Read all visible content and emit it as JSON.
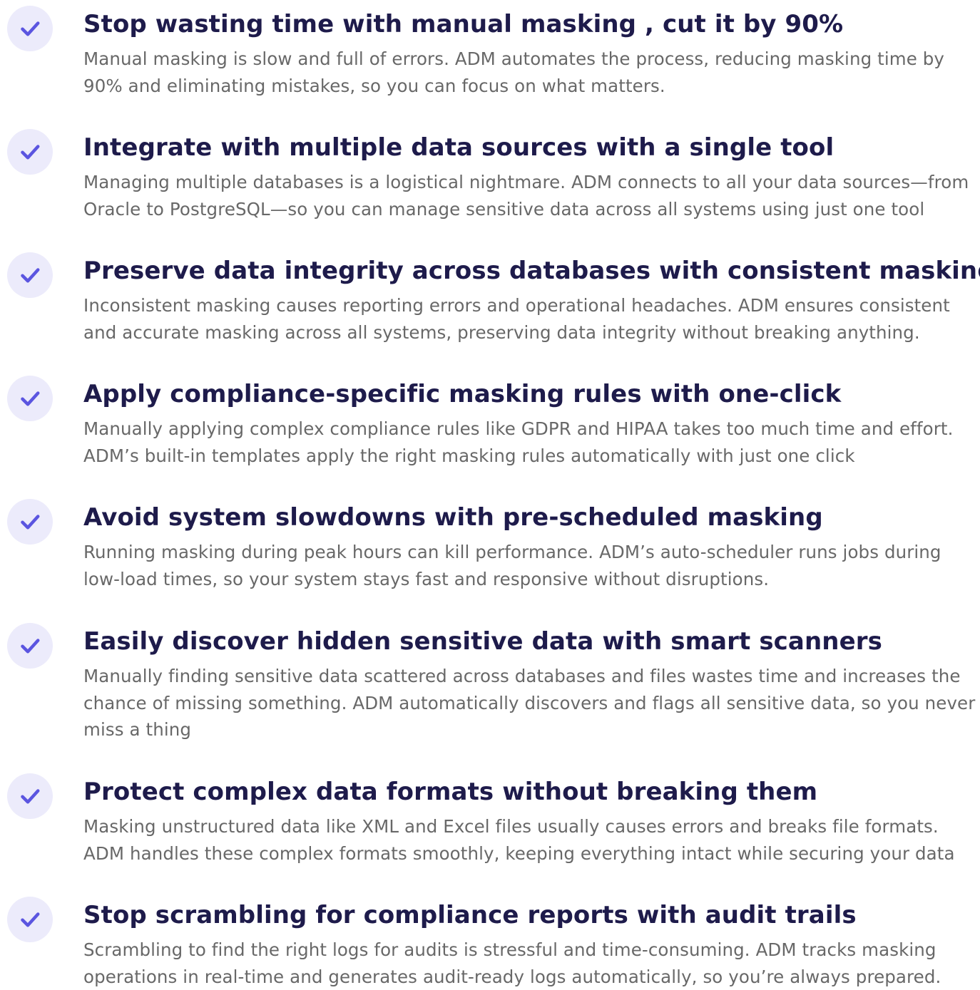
{
  "colors": {
    "title": "#1e1b4b",
    "description": "#686868",
    "check_icon": "#5b55e0",
    "check_badge_background": "#ecebfb",
    "page_background": "#ffffff"
  },
  "features": [
    {
      "icon": "check-icon",
      "title": "Stop wasting time with manual masking , cut it by 90%",
      "description": "Manual masking is slow and full of errors. ADM automates the process, reducing masking time by\n90% and eliminating mistakes, so you can focus on what matters."
    },
    {
      "icon": "check-icon",
      "title": "Integrate with multiple data sources with a single tool",
      "description": "Managing multiple databases is a logistical nightmare. ADM connects to all your data sources—from\nOracle to PostgreSQL—so you can manage sensitive data across all systems using just one tool"
    },
    {
      "icon": "check-icon",
      "title": "Preserve data integrity across databases with consistent masking",
      "description": "Inconsistent masking causes reporting errors and operational headaches. ADM ensures consistent\nand accurate masking across all systems, preserving data integrity without breaking anything."
    },
    {
      "icon": "check-icon",
      "title": "Apply compliance-specific masking rules with one-click",
      "description": "Manually applying complex compliance rules like GDPR and HIPAA takes too much time and effort.\nADM’s built-in templates apply the right masking rules automatically with just one click"
    },
    {
      "icon": "check-icon",
      "title": "Avoid system slowdowns with pre-scheduled masking",
      "description": "Running masking during peak hours can kill performance. ADM’s auto-scheduler runs jobs during\nlow-load times, so your system stays fast and responsive without disruptions."
    },
    {
      "icon": "check-icon",
      "title": "Easily discover hidden sensitive data with smart scanners",
      "description": "Manually finding sensitive data scattered across databases and files wastes time and increases the\nchance of missing something. ADM automatically discovers and flags all sensitive data, so you never\nmiss a thing"
    },
    {
      "icon": "check-icon",
      "title": "Protect complex data formats without breaking them",
      "description": "Masking unstructured data like XML and Excel files usually causes errors and breaks file formats.\nADM handles these complex formats smoothly, keeping everything intact while securing your data"
    },
    {
      "icon": "check-icon",
      "title": "Stop scrambling for compliance reports with audit trails",
      "description": "Scrambling to find the right logs for audits is stressful and time-consuming. ADM tracks masking\noperations in real-time and generates audit-ready logs automatically, so you’re always prepared."
    }
  ]
}
